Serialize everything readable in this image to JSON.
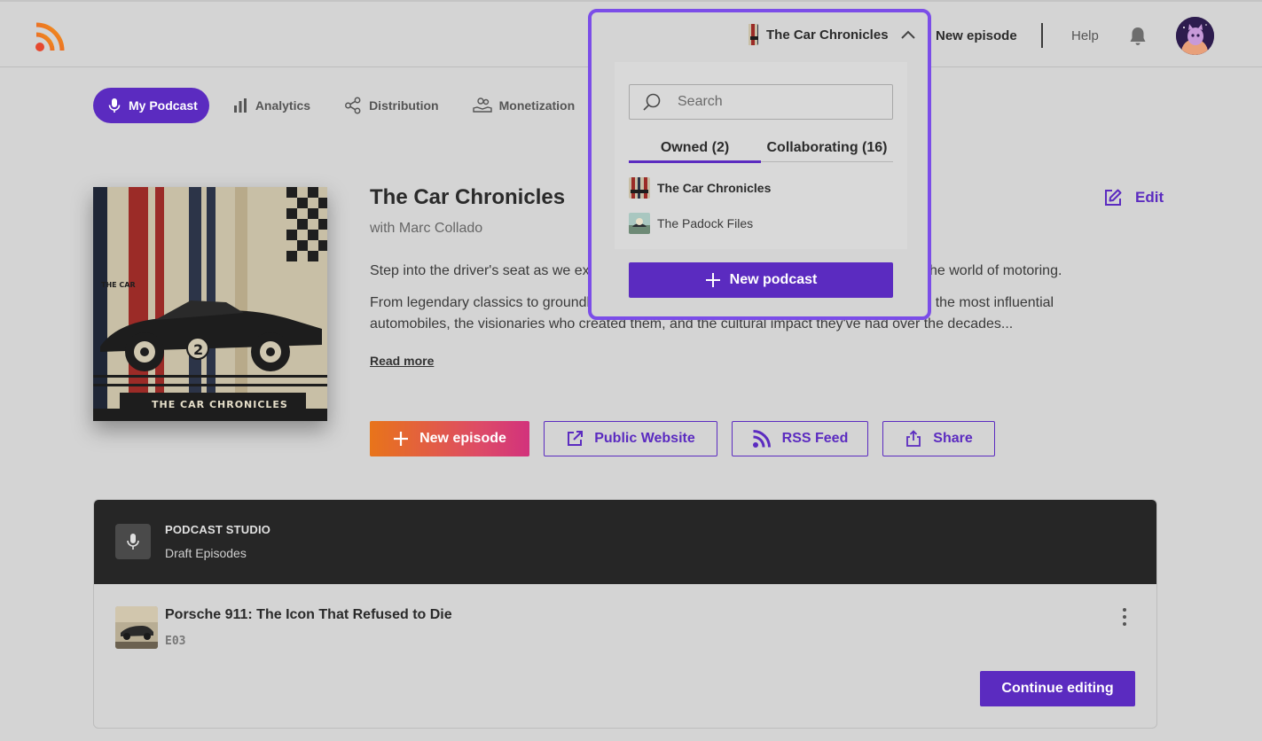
{
  "topbar": {
    "new_episode_label": "New episode",
    "help_label": "Help"
  },
  "nav": {
    "items": [
      {
        "label": "My Podcast",
        "icon": "mic-icon",
        "active": true
      },
      {
        "label": "Analytics",
        "icon": "bar-chart-icon",
        "active": false
      },
      {
        "label": "Distribution",
        "icon": "share-nodes-icon",
        "active": false
      },
      {
        "label": "Monetization",
        "icon": "hand-coins-icon",
        "active": false
      }
    ]
  },
  "podcast": {
    "title": "The Car Chronicles",
    "host": "with Marc Collado",
    "desc_line1": "Step into the driver's seat as we explo",
    "desc_line1_tail": "he world of motoring.",
    "desc_line2": "From legendary classics to groundbre",
    "desc_line2_tail": "hind the most influential",
    "desc_line3": "automobiles, the visionaries who created them, and the cultural impact they've had over the decades...",
    "read_more": "Read more",
    "edit_label": "Edit",
    "cover_text_small": "THE CAR",
    "cover_text_title": "THE CAR CHRONICLES",
    "cover_number": "2"
  },
  "actions": {
    "new_episode": "New episode",
    "public_website": "Public Website",
    "rss_feed": "RSS Feed",
    "share": "Share"
  },
  "studio": {
    "label": "PODCAST STUDIO",
    "sub": "Draft Episodes",
    "episode": {
      "title": "Porsche 911: The Icon That Refused to Die",
      "code": "E03"
    },
    "continue_label": "Continue editing"
  },
  "dropdown": {
    "current": "The Car Chronicles",
    "search_placeholder": "Search",
    "tabs": [
      {
        "label": "Owned (2)",
        "active": true
      },
      {
        "label": "Collaborating (16)",
        "active": false
      }
    ],
    "items": [
      {
        "label": "The Car Chronicles",
        "selected": true
      },
      {
        "label": "The Padock Files",
        "selected": false
      }
    ],
    "new_podcast": "New podcast"
  },
  "colors": {
    "accent": "#5b2bc0",
    "highlight_frame": "#7b4de8",
    "studio_header": "#262626",
    "gradient_start": "#e8741a",
    "gradient_end": "#d2327c"
  }
}
